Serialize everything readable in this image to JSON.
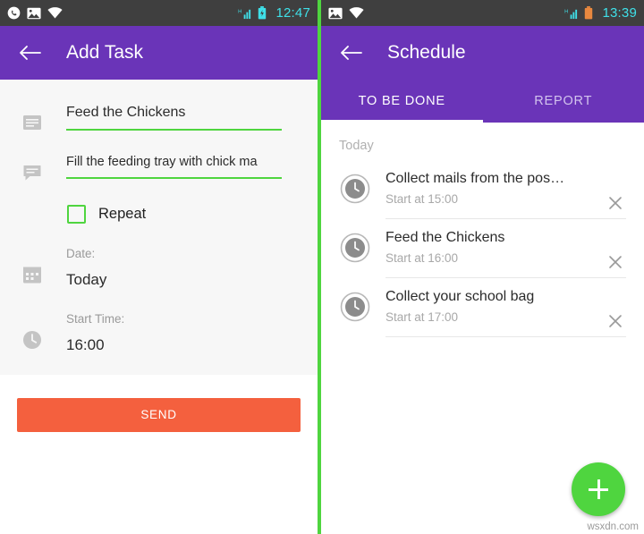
{
  "left": {
    "statusbar": {
      "time": "12:47",
      "icons": [
        "whatsapp-icon",
        "photos-icon",
        "wifi-icon",
        "signal-icon",
        "battery-icon"
      ]
    },
    "appbar": {
      "back_icon": "arrow-back-icon",
      "title": "Add Task"
    },
    "form": {
      "title_field": {
        "icon": "subject-icon",
        "value": "Feed the Chickens"
      },
      "description_field": {
        "icon": "comment-icon",
        "value": "Fill the feeding tray with chick ma"
      },
      "repeat": {
        "label": "Repeat",
        "checked": false
      },
      "date": {
        "icon": "calendar-icon",
        "label": "Date:",
        "value": "Today"
      },
      "start_time": {
        "icon": "clock-icon",
        "label": "Start Time:",
        "value": "16:00"
      },
      "send_button": "SEND"
    }
  },
  "right": {
    "statusbar": {
      "time": "13:39",
      "icons": [
        "photos-icon",
        "wifi-icon",
        "signal-icon",
        "battery-icon"
      ]
    },
    "appbar": {
      "back_icon": "arrow-back-icon",
      "title": "Schedule"
    },
    "tabs": [
      {
        "label": "TO BE DONE",
        "active": true
      },
      {
        "label": "REPORT",
        "active": false
      }
    ],
    "section_label": "Today",
    "tasks": [
      {
        "title": "Collect mails from the pos…",
        "subtitle": "Start at 15:00"
      },
      {
        "title": "Feed the Chickens",
        "subtitle": "Start at 16:00"
      },
      {
        "title": "Collect your school bag",
        "subtitle": "Start at 17:00"
      }
    ],
    "fab": "add-task-fab",
    "watermark": "wsxdn.com"
  },
  "colors": {
    "primary": "#6a34b8",
    "accent_green": "#4fd53f",
    "send_orange": "#f4603e",
    "statusbar": "#3f3f3f",
    "clock_cyan": "#3fe0e8"
  }
}
